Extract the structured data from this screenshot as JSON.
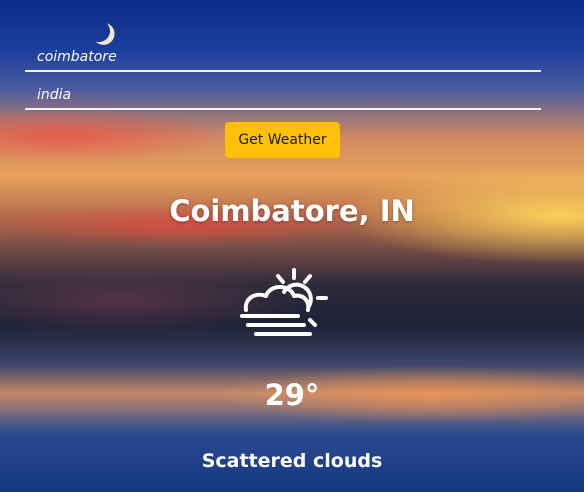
{
  "form": {
    "city_value": "coimbatore",
    "country_value": "india",
    "submit_label": "Get Weather"
  },
  "weather": {
    "location": "Coimbatore, IN",
    "icon": "partly-cloudy-sun-icon",
    "temperature": "29°",
    "description": "Scattered clouds"
  },
  "colors": {
    "button": "#ffc107",
    "text": "#ffffff"
  }
}
